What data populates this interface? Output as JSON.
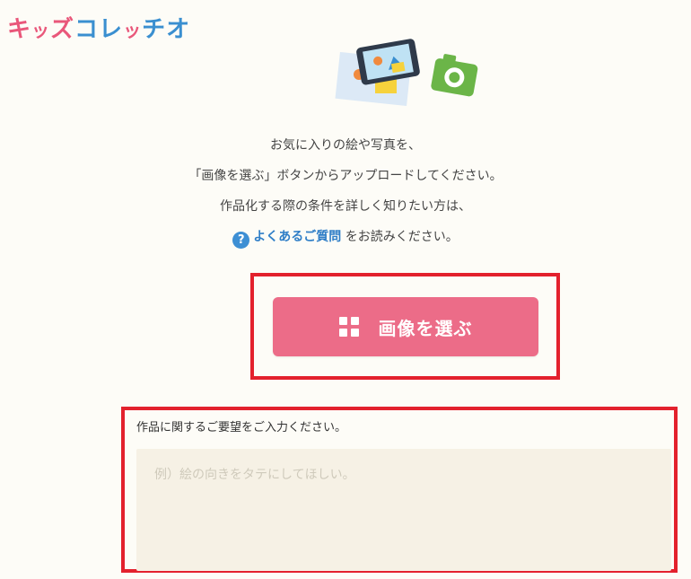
{
  "logo": {
    "chars": [
      {
        "ch": "キ",
        "color": "#e9577a"
      },
      {
        "ch": "ッ",
        "color": "#e9577a"
      },
      {
        "ch": "ズ",
        "color": "#e9577a"
      },
      {
        "ch": "コ",
        "color": "#3a8fd0"
      },
      {
        "ch": "レ",
        "color": "#3a8fd0"
      },
      {
        "ch": "ッ",
        "color": "#e9577a"
      },
      {
        "ch": "チ",
        "color": "#3a8fd0"
      },
      {
        "ch": "オ",
        "color": "#3a8fd0"
      }
    ]
  },
  "hero_icons": [
    "photo-icon",
    "smartphone-icon",
    "camera-icon"
  ],
  "intro": {
    "line1": "お気に入りの絵や写真を、",
    "line2": "「画像を選ぶ」ボタンからアップロードしてください。",
    "line3": "作品化する際の条件を詳しく知りたい方は、",
    "faq_icon": "?",
    "faq_link": "よくあるご質問",
    "faq_suffix": " をお読みください。"
  },
  "choose_button": {
    "label": "画像を選ぶ",
    "icon": "grid-icon",
    "color": "#ec6c88"
  },
  "request": {
    "label": "作品に関するご要望をご入力ください。",
    "placeholder": "例）絵の向きをタテにしてほしい。",
    "value": ""
  },
  "colors": {
    "highlight": "#e3212d",
    "link": "#2f7ec7",
    "background": "#fdfcf7",
    "textarea_bg": "#f6f1e5"
  }
}
